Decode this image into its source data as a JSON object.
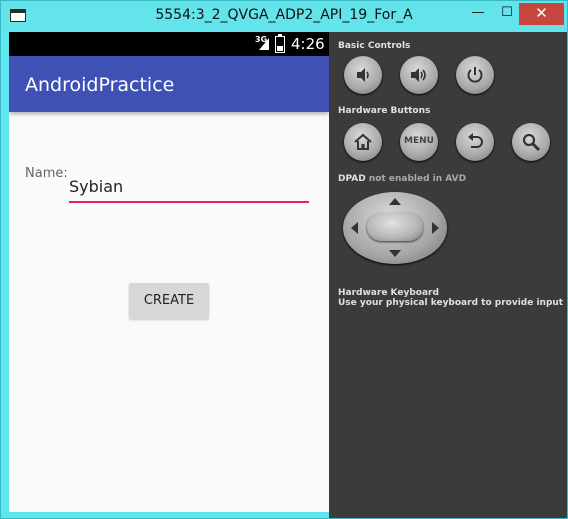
{
  "window": {
    "title": "5554:3_2_QVGA_ADP2_API_19_For_A",
    "minimize": "—",
    "maximize": "☐",
    "close": "✕"
  },
  "statusbar": {
    "network": "3G",
    "time": "4:26"
  },
  "app": {
    "title": "AndroidPractice",
    "name_label": "Name:",
    "name_value": "Sybian",
    "create_label": "CREATE"
  },
  "colors": {
    "toolbar": "#3f51b5",
    "accent": "#e91e63",
    "panel": "#3b3b3b"
  },
  "controls": {
    "basic_title": "Basic Controls",
    "basic_buttons": [
      "volume-down-icon",
      "volume-up-icon",
      "power-icon"
    ],
    "hardware_title": "Hardware Buttons",
    "hardware_buttons": [
      "home-icon",
      "menu-icon",
      "back-icon",
      "search-icon"
    ],
    "menu_label": "MENU",
    "dpad_title": "DPAD",
    "dpad_note": "not enabled in AVD",
    "keyboard_title": "Hardware Keyboard",
    "keyboard_note": "Use your physical keyboard to provide input"
  }
}
